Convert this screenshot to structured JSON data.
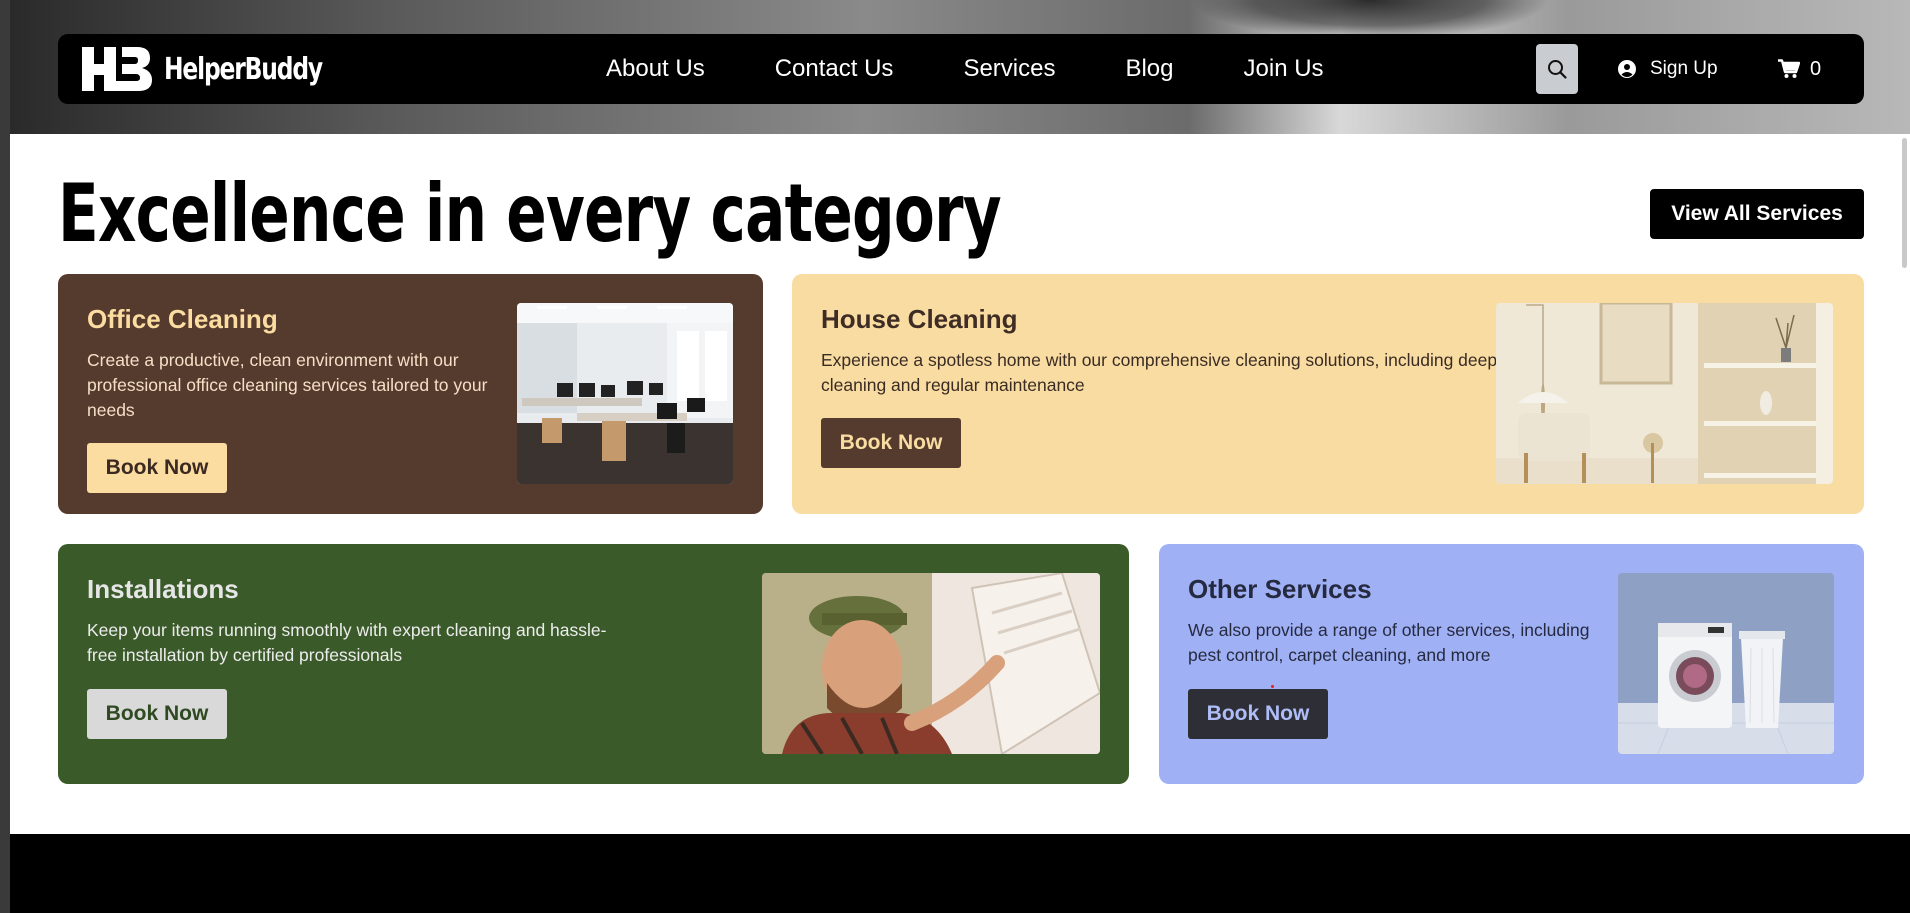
{
  "brand": {
    "name": "HelperBuddy",
    "logo_mark": "HB"
  },
  "nav": {
    "links": [
      "About Us",
      "Contact Us",
      "Services",
      "Blog",
      "Join Us"
    ],
    "signup_label": "Sign Up",
    "cart_count": "0"
  },
  "section": {
    "heading": "Excellence in every category",
    "view_all_label": "View All Services"
  },
  "cards": [
    {
      "title": "Office Cleaning",
      "description": "Create a productive, clean environment with our professional office cleaning services tailored to your needs",
      "button": "Book Now"
    },
    {
      "title": "House Cleaning",
      "description": "Experience a spotless home with our comprehensive cleaning solutions, including deep cleaning and regular maintenance",
      "button": "Book Now"
    },
    {
      "title": "Installations",
      "description": "Keep your items running smoothly with expert cleaning and hassle-free installation by certified professionals",
      "button": "Book Now"
    },
    {
      "title": "Other Services",
      "description": "We also provide a range of other services, including pest control, carpet cleaning, and more",
      "button": "Book Now"
    }
  ],
  "icons": {
    "search": "search-icon",
    "user": "user-circle-icon",
    "cart": "cart-icon"
  },
  "colors": {
    "office_bg": "#553a2e",
    "office_accent": "#fbdca1",
    "house_bg": "#f9dca2",
    "install_bg": "#3b5a2a",
    "other_bg": "#9fb0f5"
  }
}
